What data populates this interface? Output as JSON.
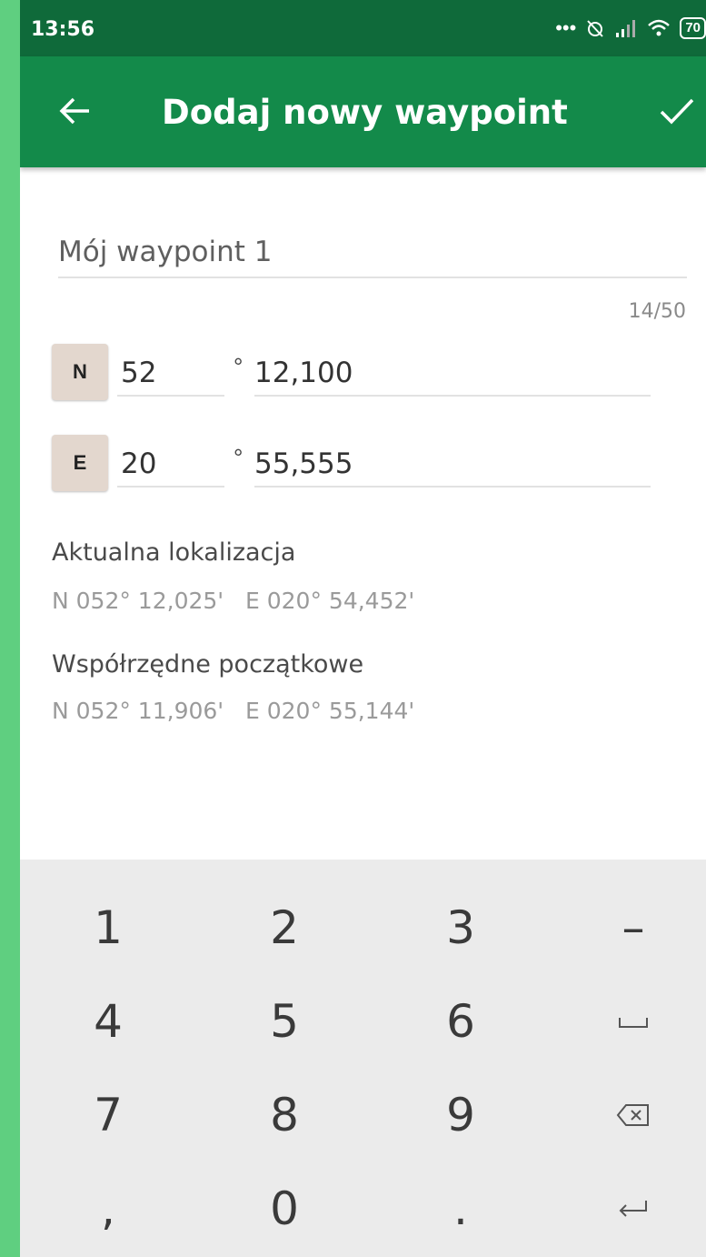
{
  "status_bar": {
    "time": "13:56",
    "battery": "70"
  },
  "app_bar": {
    "title": "Dodaj nowy waypoint"
  },
  "form": {
    "name_value": "Mój waypoint 1",
    "char_counter": "14/50",
    "latitude": {
      "hemisphere": "N",
      "degrees": "52",
      "degree_symbol": "°",
      "minutes": "12,100"
    },
    "longitude": {
      "hemisphere": "E",
      "degrees": "20",
      "degree_symbol": "°",
      "minutes": "55,555"
    }
  },
  "info": {
    "current_location_label": "Aktualna lokalizacja",
    "current_location_value": "N 052° 12,025'   E 020° 54,452'",
    "initial_coords_label": "Współrzędne początkowe",
    "initial_coords_value": "N 052° 11,906'   E 020° 55,144'"
  },
  "keyboard": {
    "keys": [
      "1",
      "2",
      "3",
      "–",
      "4",
      "5",
      "6",
      "␣",
      "7",
      "8",
      "9",
      "⌫",
      ",",
      "0",
      ".",
      "↵"
    ]
  },
  "colors": {
    "status_bar": "#0f6a3a",
    "app_bar": "#138a4a",
    "outer_frame": "#5fcf80",
    "hemisphere_button": "#e3d7ce"
  }
}
